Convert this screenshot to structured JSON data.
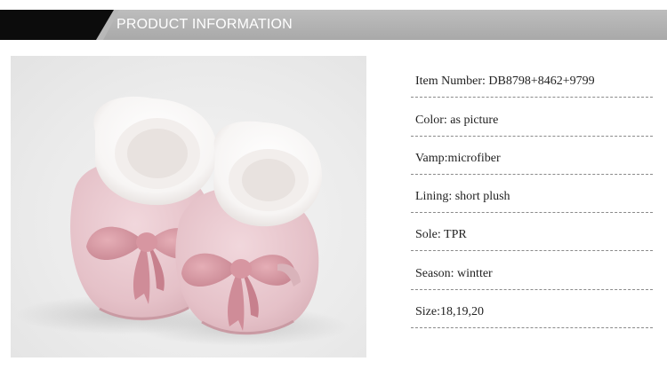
{
  "header": {
    "title": "PRODUCT INFORMATION"
  },
  "photo": {
    "subject": "pink-baby-shoes-with-fur-and-bows"
  },
  "info": {
    "rows": [
      "Item Number: DB8798+8462+9799",
      "Color: as picture",
      "Vamp:microfiber",
      "Lining: short plush",
      "Sole: TPR",
      "Season: wintter",
      "Size:18,19,20"
    ]
  },
  "colors": {
    "header_black": "#0c0c0c",
    "header_gray": "#b3b3b3",
    "shoe_pink": "#e9c8cf",
    "bow_pink": "#d89aa4",
    "fur_white": "#fbfbfb",
    "divider": "#8a8a8a"
  }
}
